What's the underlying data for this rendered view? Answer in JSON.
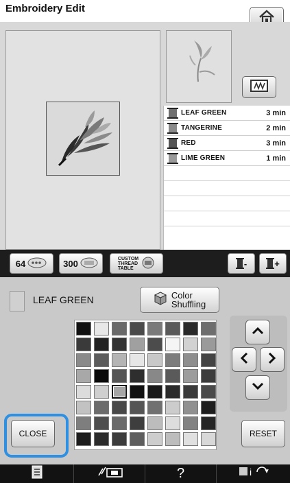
{
  "title": "Embroidery Edit",
  "threads": [
    {
      "name": "LEAF GREEN",
      "time": "3 min",
      "color": "#6f6f6f"
    },
    {
      "name": "TANGERINE",
      "time": "2 min",
      "color": "#8a8a8a"
    },
    {
      "name": "RED",
      "time": "3 min",
      "color": "#555555"
    },
    {
      "name": "LIME GREEN",
      "time": "1 min",
      "color": "#9a9a9a"
    }
  ],
  "toolbar": {
    "btn64": "64",
    "btn300": "300",
    "custom_table": [
      "CUSTOM",
      "THREAD",
      "TABLE"
    ],
    "minus_label": "-",
    "plus_label": "+"
  },
  "selection": {
    "current_thread": "LEAF GREEN",
    "shuffle_label": [
      "Color",
      "Shuffling"
    ]
  },
  "buttons": {
    "close": "CLOSE",
    "reset": "RESET",
    "help": "?"
  },
  "palette_colors": [
    "#111111",
    "#e8e8e8",
    "#6a6a6a",
    "#4a4a4a",
    "#7a7a7a",
    "#5a5a5a",
    "#2a2a2a",
    "#6e6e6e",
    "#3a3a3a",
    "#222222",
    "#333333",
    "#a0a0a0",
    "#4c4c4c",
    "#f5f5f5",
    "#d2d2d2",
    "#9a9a9a",
    "#8a8a8a",
    "#5c5c5c",
    "#b4b4b4",
    "#e6e6e6",
    "#c8c8c8",
    "#7c7c7c",
    "#8e8e8e",
    "#444444",
    "#a8a8a8",
    "#0a0a0a",
    "#555555",
    "#2e2e2e",
    "#888888",
    "#5a5a5a",
    "#9c9c9c",
    "#3c3c3c",
    "#dcdcdc",
    "#cfcfcf",
    "#a6a6a6",
    "#111111",
    "#1a1a1a",
    "#2a2a2a",
    "#3a3a3a",
    "#4a4a4a",
    "#c2c2c2",
    "#6c6c6c",
    "#484848",
    "#555555",
    "#707070",
    "#cccccc",
    "#909090",
    "#1e1e1e",
    "#7e7e7e",
    "#4e4e4e",
    "#6a6a6a",
    "#3e3e3e",
    "#bcbcbc",
    "#dddddd",
    "#828282",
    "#262626",
    "#1c1c1c",
    "#2c2c2c",
    "#3c3c3c",
    "#5e5e5e",
    "#cdcdcd",
    "#bdbdbd",
    "#e0e0e0",
    "#d8d8d8"
  ],
  "selected_cell_index": 34
}
